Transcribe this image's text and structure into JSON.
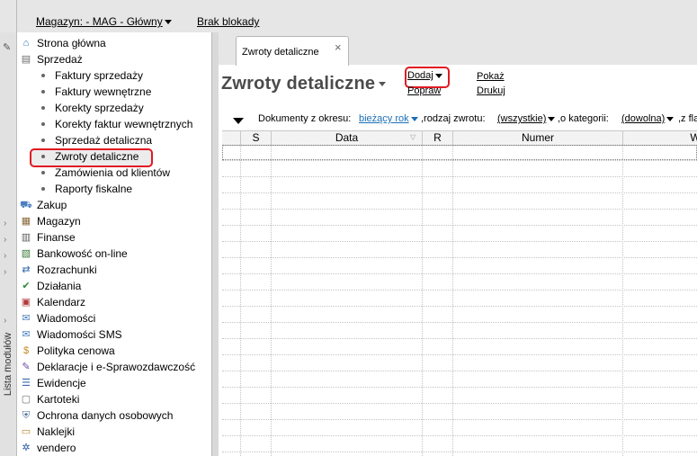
{
  "topbar": {
    "magazyn": "Magazyn: - MAG - Główny",
    "blokady": "Brak blokady"
  },
  "modules_label": "Lista modułów",
  "sidebar": {
    "items": [
      {
        "label": "Strona główna",
        "icon": "home-icon",
        "level": 0
      },
      {
        "label": "Sprzedaż",
        "icon": "sales-icon",
        "level": 0
      },
      {
        "label": "Faktury sprzedaży",
        "level": 1
      },
      {
        "label": "Faktury wewnętrzne",
        "level": 1
      },
      {
        "label": "Korekty sprzedaży",
        "level": 1
      },
      {
        "label": "Korekty faktur wewnętrznych",
        "level": 1
      },
      {
        "label": "Sprzedaż detaliczna",
        "level": 1
      },
      {
        "label": "Zwroty detaliczne",
        "level": 1,
        "selected": true
      },
      {
        "label": "Zamówienia od klientów",
        "level": 1
      },
      {
        "label": "Raporty fiskalne",
        "level": 1
      },
      {
        "label": "Zakup",
        "icon": "purchase-icon",
        "level": 0
      },
      {
        "label": "Magazyn",
        "icon": "warehouse-icon",
        "level": 0
      },
      {
        "label": "Finanse",
        "icon": "finance-icon",
        "level": 0
      },
      {
        "label": "Bankowość on-line",
        "icon": "bank-icon",
        "level": 0
      },
      {
        "label": "Rozrachunki",
        "icon": "settlements-icon",
        "level": 0
      },
      {
        "label": "Działania",
        "icon": "actions-icon",
        "level": 0
      },
      {
        "label": "Kalendarz",
        "icon": "calendar-icon",
        "level": 0
      },
      {
        "label": "Wiadomości",
        "icon": "messages-icon",
        "level": 0
      },
      {
        "label": "Wiadomości SMS",
        "icon": "sms-icon",
        "level": 0
      },
      {
        "label": "Polityka cenowa",
        "icon": "pricing-icon",
        "level": 0
      },
      {
        "label": "Deklaracje i e-Sprawozdawczość",
        "icon": "declarations-icon",
        "level": 0
      },
      {
        "label": "Ewidencje",
        "icon": "records-icon",
        "level": 0
      },
      {
        "label": "Kartoteki",
        "icon": "files-icon",
        "level": 0
      },
      {
        "label": "Ochrona danych osobowych",
        "icon": "shield-icon",
        "level": 0
      },
      {
        "label": "Naklejki",
        "icon": "labels-icon",
        "level": 0
      },
      {
        "label": "vendero",
        "icon": "vendero-icon",
        "level": 0
      }
    ]
  },
  "tab": {
    "label": "Zwroty detaliczne",
    "close": "×"
  },
  "page": {
    "title": "Zwroty detaliczne",
    "actions": {
      "dodaj": "Dodaj",
      "popraw": "Popraw",
      "pokaz": "Pokaż",
      "drukuj": "Drukuj"
    }
  },
  "filters": {
    "period_label": "Dokumenty z okresu:",
    "period_value": "bieżący rok",
    "type_label": ",rodzaj zwrotu:",
    "type_value": "(wszystkie)",
    "category_label": ",o kategorii:",
    "category_value": "(dowolna)",
    "more_label": ",z fla"
  },
  "table": {
    "columns": [
      "",
      "S",
      "Data",
      "R",
      "Numer",
      "W"
    ]
  }
}
